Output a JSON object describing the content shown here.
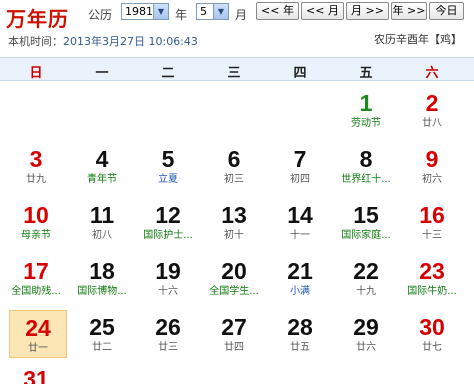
{
  "header": {
    "title": "万年历",
    "gongli_label": "公历",
    "year_value": "1981",
    "year_label": "年",
    "month_value": "5",
    "month_label": "月",
    "buttons": {
      "prev_year": "<< 年",
      "prev_month": "<< 月",
      "next_month": "月 >>",
      "next_year": "年 >>",
      "today": "今日"
    }
  },
  "now": {
    "label": "本机时间：",
    "value": "2013年3月27日 10:06:43"
  },
  "lunar_year": "农历辛酉年【鸡】",
  "weekdays": [
    "日",
    "一",
    "二",
    "三",
    "四",
    "五",
    "六"
  ],
  "days": [
    {
      "n": "1",
      "sub": "劳动节"
    },
    {
      "n": "2",
      "sub": "廿八"
    },
    {
      "n": "3",
      "sub": "廿九"
    },
    {
      "n": "4",
      "sub": "青年节"
    },
    {
      "n": "5",
      "sub": "立夏"
    },
    {
      "n": "6",
      "sub": "初三"
    },
    {
      "n": "7",
      "sub": "初四"
    },
    {
      "n": "8",
      "sub": "世界红十..."
    },
    {
      "n": "9",
      "sub": "初六"
    },
    {
      "n": "10",
      "sub": "母亲节"
    },
    {
      "n": "11",
      "sub": "初八"
    },
    {
      "n": "12",
      "sub": "国际护士..."
    },
    {
      "n": "13",
      "sub": "初十"
    },
    {
      "n": "14",
      "sub": "十一"
    },
    {
      "n": "15",
      "sub": "国际家庭..."
    },
    {
      "n": "16",
      "sub": "十三"
    },
    {
      "n": "17",
      "sub": "全国助残..."
    },
    {
      "n": "18",
      "sub": "国际博物..."
    },
    {
      "n": "19",
      "sub": "十六"
    },
    {
      "n": "20",
      "sub": "全国学生..."
    },
    {
      "n": "21",
      "sub": "小满"
    },
    {
      "n": "22",
      "sub": "十九"
    },
    {
      "n": "23",
      "sub": "国际牛奶..."
    },
    {
      "n": "24",
      "sub": "廿一"
    },
    {
      "n": "25",
      "sub": "廿二"
    },
    {
      "n": "26",
      "sub": "廿三"
    },
    {
      "n": "27",
      "sub": "廿四"
    },
    {
      "n": "28",
      "sub": "廿五"
    },
    {
      "n": "29",
      "sub": "廿六"
    },
    {
      "n": "30",
      "sub": "廿七"
    },
    {
      "n": "31",
      "sub": ""
    }
  ],
  "colors": {
    "brand_red": "#cc1100",
    "weekend_red": "#d70000",
    "holiday_green": "#1b8c1b",
    "festival_text": "#0e7a0e",
    "solar_term_text": "#1e55b0",
    "today_bg": "#fde6b6",
    "weekbar_bg": "#eaf2fb"
  },
  "icons": {
    "select_arrow": "chevron-down-icon"
  }
}
